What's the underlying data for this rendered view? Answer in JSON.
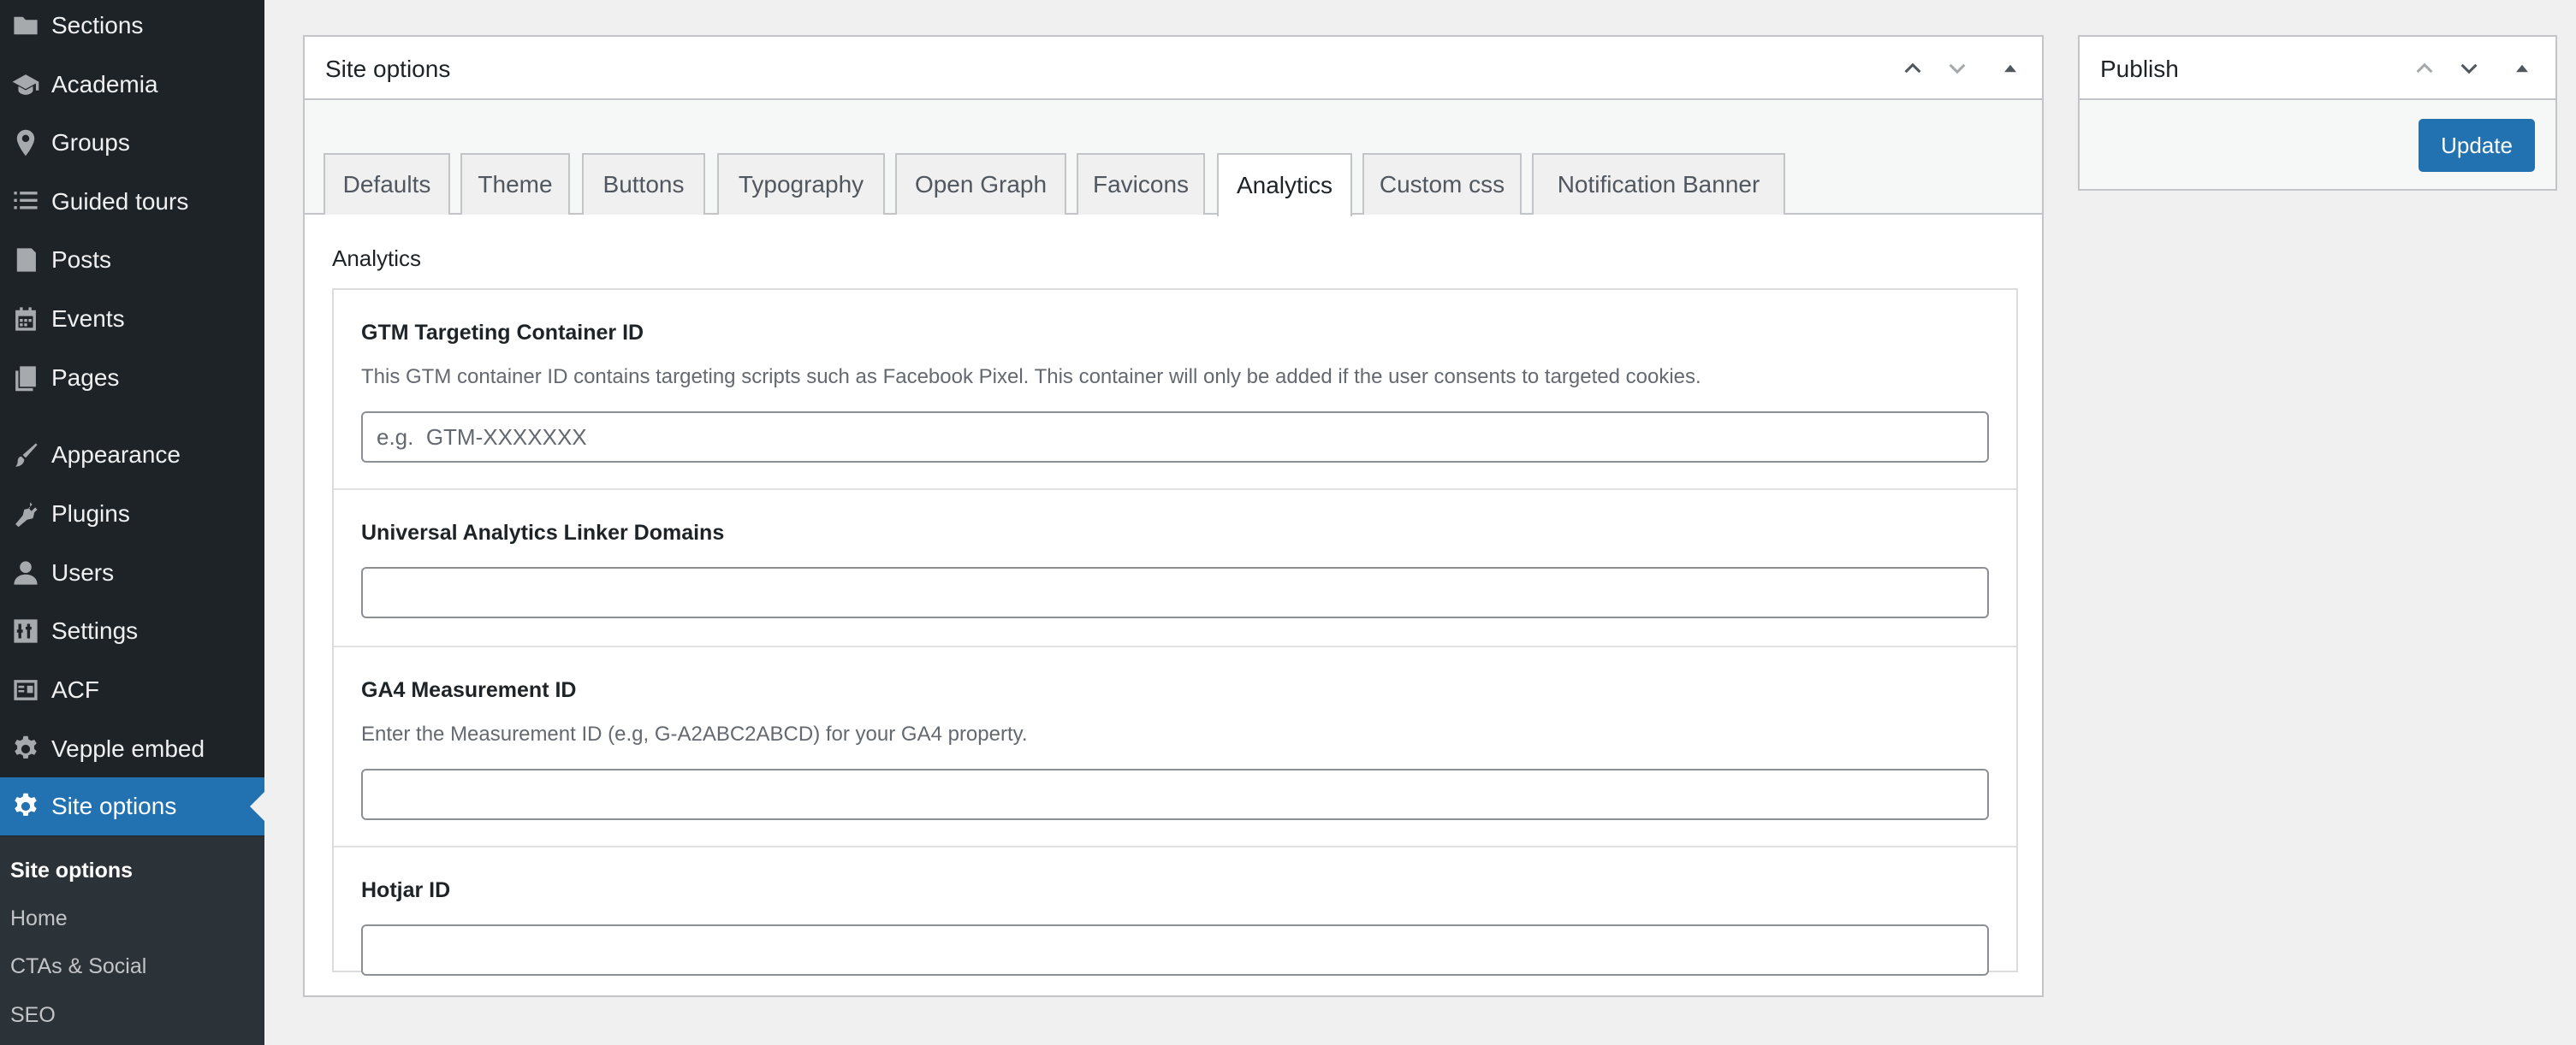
{
  "sidebar": {
    "items": [
      {
        "label": "Sections",
        "icon": "folder-icon"
      },
      {
        "label": "Academia",
        "icon": "graduation-cap-icon"
      },
      {
        "label": "Groups",
        "icon": "location-pin-icon"
      },
      {
        "label": "Guided tours",
        "icon": "list-icon"
      },
      {
        "label": "Posts",
        "icon": "posts-icon"
      },
      {
        "label": "Events",
        "icon": "calendar-icon"
      },
      {
        "label": "Pages",
        "icon": "pages-icon"
      },
      {
        "label": "Appearance",
        "icon": "brush-icon"
      },
      {
        "label": "Plugins",
        "icon": "plugin-icon"
      },
      {
        "label": "Users",
        "icon": "user-icon"
      },
      {
        "label": "Settings",
        "icon": "settings-sliders-icon"
      },
      {
        "label": "ACF",
        "icon": "acf-icon"
      },
      {
        "label": "Vepple embed",
        "icon": "gear-icon"
      },
      {
        "label": "Site options",
        "icon": "gear-icon",
        "current": true
      }
    ],
    "submenu": [
      {
        "label": "Site options",
        "active": true
      },
      {
        "label": "Home"
      },
      {
        "label": "CTAs & Social"
      },
      {
        "label": "SEO"
      }
    ]
  },
  "metabox": {
    "title": "Site options",
    "tabs": [
      {
        "label": "Defaults"
      },
      {
        "label": "Theme"
      },
      {
        "label": "Buttons"
      },
      {
        "label": "Typography"
      },
      {
        "label": "Open Graph"
      },
      {
        "label": "Favicons"
      },
      {
        "label": "Analytics",
        "active": true
      },
      {
        "label": "Custom css"
      },
      {
        "label": "Notification Banner"
      }
    ],
    "section_label": "Analytics",
    "fields": [
      {
        "label": "GTM Targeting Container ID",
        "description": "This GTM container ID contains targeting scripts such as Facebook Pixel. This container will only be added if the user consents to targeted cookies.",
        "placeholder": "e.g.  GTM-XXXXXXX",
        "value": ""
      },
      {
        "label": "Universal Analytics Linker Domains",
        "description": "",
        "placeholder": "",
        "value": ""
      },
      {
        "label": "GA4 Measurement ID",
        "description": "Enter the Measurement ID (e.g, G-A2ABC2ABCD) for your GA4 property.",
        "placeholder": "",
        "value": ""
      },
      {
        "label": "Hotjar ID",
        "description": "",
        "placeholder": "",
        "value": ""
      }
    ]
  },
  "publish": {
    "title": "Publish",
    "update_label": "Update"
  },
  "colors": {
    "sidebar_bg": "#1d2327",
    "submenu_bg": "#2c3338",
    "accent": "#2271b1",
    "page_bg": "#f0f0f1"
  }
}
